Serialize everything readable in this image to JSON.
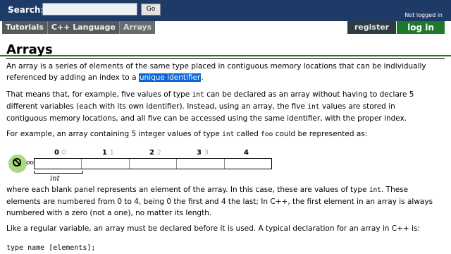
{
  "header": {
    "search_label": "Search:",
    "search_value": "",
    "go_label": "Go",
    "login_status": "Not logged in"
  },
  "breadcrumb": [
    "Tutorials",
    "C++ Language",
    "Arrays"
  ],
  "user": {
    "register_label": "register",
    "login_label": "log in"
  },
  "colors": {
    "topbar": "#1d3b66",
    "login_green": "#1e7a2a",
    "highlight": "#0a64d6"
  },
  "content": {
    "title": "Arrays",
    "p1_line1": "An array is a series of elements of the same type placed in contiguous memory locations that can be individually",
    "p1_line2_pre": "referenced by adding an index to a ",
    "p1_line2_link": "unique identifier",
    "p1_line2_post": ".",
    "p2_line1_pre": "That means that, for example, five values of type ",
    "p2_line1_code": "int",
    "p2_line1_post": " can be declared as an array without having to declare 5",
    "p2_line2_pre": "different variables (each with its own identifier). Instead, using an array, the five ",
    "p2_line2_code": "int",
    "p2_line2_post": " values are stored in",
    "p2_line3": "contiguous memory locations, and all five can be accessed using the same identifier, with the proper index.",
    "p3_pre": "For example, an array containing 5 integer values of type ",
    "p3_code1": "int",
    "p3_mid": " called ",
    "p3_code2": "foo",
    "p3_post": " could be represented as:",
    "p4_line1_pre": "where each blank panel represents an element of the array. In this case, these are values of type ",
    "p4_line1_code": "int",
    "p4_line1_post": ". These",
    "p4_line2": "elements are numbered from 0 to 4, being 0 the first and 4 the last; In C++, the first element in an array is always",
    "p4_line3": "numbered with a zero (not a one), no matter its length.",
    "p5": "Like a regular variable, an array must be declared before it is used. A typical declaration for an array in C++ is:",
    "code_line": "type name [elements];"
  },
  "diagram": {
    "prefix": "oo",
    "indices": [
      {
        "main": "0",
        "ghost": "0"
      },
      {
        "main": "1",
        "ghost": "1"
      },
      {
        "main": "2",
        "ghost": "2"
      },
      {
        "main": "3",
        "ghost": "3"
      },
      {
        "main": "4",
        "ghost": ""
      }
    ],
    "type_label": "int"
  }
}
